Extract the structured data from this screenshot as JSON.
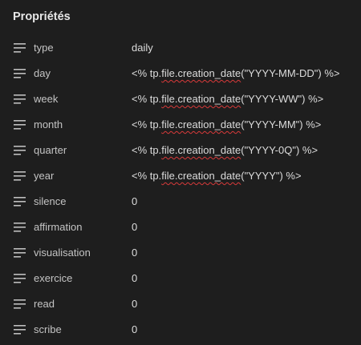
{
  "panel": {
    "title": "Propriétés"
  },
  "properties": [
    {
      "key": "type",
      "value_pre": "daily",
      "value_mid": "",
      "value_post": ""
    },
    {
      "key": "day",
      "value_pre": "<% tp.",
      "value_mid": "file.creation_date",
      "value_post": "(\"YYYY-MM-DD\") %>"
    },
    {
      "key": "week",
      "value_pre": "<% tp.",
      "value_mid": "file.creation_date",
      "value_post": "(\"YYYY-WW\") %>"
    },
    {
      "key": "month",
      "value_pre": "<% tp.",
      "value_mid": "file.creation_date",
      "value_post": "(\"YYYY-MM\") %>"
    },
    {
      "key": "quarter",
      "value_pre": "<% tp.",
      "value_mid": "file.creation_date",
      "value_post": "(\"YYYY-0Q\") %>"
    },
    {
      "key": "year",
      "value_pre": "<% tp.",
      "value_mid": "file.creation_date",
      "value_post": "(\"YYYY\") %>"
    },
    {
      "key": "silence",
      "value_pre": "0",
      "value_mid": "",
      "value_post": ""
    },
    {
      "key": "affirmation",
      "value_pre": "0",
      "value_mid": "",
      "value_post": ""
    },
    {
      "key": "visualisation",
      "value_pre": "0",
      "value_mid": "",
      "value_post": ""
    },
    {
      "key": "exercice",
      "value_pre": "0",
      "value_mid": "",
      "value_post": ""
    },
    {
      "key": "read",
      "value_pre": "0",
      "value_mid": "",
      "value_post": ""
    },
    {
      "key": "scribe",
      "value_pre": "0",
      "value_mid": "",
      "value_post": ""
    }
  ],
  "icons": {
    "property_type": "text-lines-icon"
  },
  "colors": {
    "background": "#1e1e1e",
    "spellcheck_underline": "#d93a3a"
  }
}
